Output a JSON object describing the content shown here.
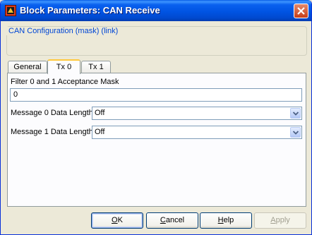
{
  "window": {
    "title": "Block Parameters: CAN Receive"
  },
  "group": {
    "title": "CAN Configuration (mask) (link)"
  },
  "tabs": [
    {
      "label": "General",
      "active": false
    },
    {
      "label": "Tx 0",
      "active": true
    },
    {
      "label": "Tx 1",
      "active": false
    }
  ],
  "params": {
    "filter_label": "Filter 0 and 1 Acceptance Mask",
    "filter_value": "0",
    "msg0_label": "Message 0 Data Length",
    "msg0_value": "Off",
    "msg1_label": "Message 1 Data Length",
    "msg1_value": "Off"
  },
  "buttons": {
    "ok": {
      "prefix": "",
      "accel": "O",
      "rest": "K"
    },
    "cancel": {
      "prefix": "",
      "accel": "C",
      "rest": "ancel"
    },
    "help": {
      "prefix": "",
      "accel": "H",
      "rest": "elp"
    },
    "apply": {
      "prefix": "",
      "accel": "A",
      "rest": "pply",
      "enabled": false
    }
  },
  "icons": {
    "app": "simulink-block-icon",
    "close": "close-icon",
    "dropdown": "chevron-down-icon"
  },
  "colors": {
    "titlebar": "#0054e3",
    "group_title": "#0046d5",
    "active_tab_accent": "#ffc83c"
  }
}
